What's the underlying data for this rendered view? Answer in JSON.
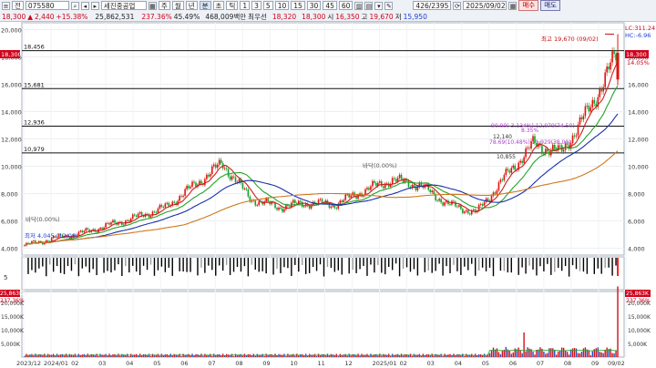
{
  "toolbar": {
    "market": "전",
    "code": "075580",
    "name": "세진중공업",
    "periods": [
      "주",
      "월",
      "년",
      "분",
      "초",
      "틱"
    ],
    "minutes": [
      "1",
      "3",
      "5",
      "10",
      "15",
      "30",
      "45",
      "60"
    ],
    "count": "426",
    "total": "2395",
    "date": "2025/09/02",
    "buy": "매수",
    "sell": "매도",
    "price_line": {
      "price": "18,300",
      "arrow": "▲",
      "change": "2,440",
      "change_pct": "+15.38%",
      "volume": "25,862,531",
      "vol_pct": "237.36%",
      "turnover_rate": "45.49%",
      "amount": "468,009백만",
      "priority": "최우선",
      "bid": "18,320",
      "close": "18,300",
      "open_label": "시",
      "open": "16,350",
      "high_label": "고",
      "high": "19,670",
      "low_label": "저",
      "low": "15,950"
    }
  },
  "price_chart": {
    "y_ticks": [
      "20,000",
      "18,000",
      "16,000",
      "14,000",
      "12,000",
      "10,000",
      "8,000",
      "6,000",
      "4,000"
    ],
    "right_ticks": [
      "20,000",
      "18,000",
      "16,000",
      "14,000",
      "12,000",
      "10,000",
      "8,000",
      "6,000",
      "4,000"
    ],
    "right_top_1": "LC:311.24",
    "right_top_2": "HC:-6.96",
    "price_badge_left": "18,300",
    "price_badge_right": "18,300",
    "price_badge_pct": "14.05%",
    "h_levels": [
      "18,456",
      "15,681",
      "12,936",
      "10,979"
    ],
    "high_annot": "최고 19,670 (09/02)",
    "low_annot": "최저 4,045 (12/09)",
    "box1": "바닥(0.00%)",
    "box2": "바닥(0.00%)",
    "fib1": "90.00(-3.134%) 12,979(74.50)",
    "fib2": "78.69(10.48%) 11,929(38.00)",
    "small1": "12,140",
    "small2": "10,855",
    "small3": "8.35%"
  },
  "volume_panel": {
    "label_left": "5",
    "colors": {
      "up": "#000000",
      "gray": "#9a9a9a",
      "red": "#ff2020"
    }
  },
  "amount_panel": {
    "badge_left": "25,863K",
    "pct_left": "237.36%",
    "badge_right": "25,863K",
    "pct_right": "237.36%",
    "y_ticks": [
      "20,000K",
      "15,000K",
      "10,000K",
      "5,000K"
    ]
  },
  "x_axis": {
    "labels": [
      "2023/12",
      "2024/01",
      "02",
      "03",
      "04",
      "05",
      "06",
      "07",
      "08",
      "09",
      "10",
      "11",
      "12",
      "2025/01",
      "02",
      "03",
      "04",
      "05",
      "06",
      "07",
      "08",
      "09",
      "09/02"
    ]
  },
  "chart_data": {
    "type": "candlestick",
    "price_high": 19670,
    "price_low": 4045,
    "last_close": 18300,
    "levels": [
      18456,
      15681,
      12936,
      10979
    ],
    "close_path": [
      {
        "x": "2023/12",
        "y": 4200
      },
      {
        "x": "2024/01",
        "y": 4700
      },
      {
        "x": "02",
        "y": 5100
      },
      {
        "x": "03",
        "y": 5700
      },
      {
        "x": "04",
        "y": 6300
      },
      {
        "x": "05",
        "y": 7000
      },
      {
        "x": "06",
        "y": 8600
      },
      {
        "x": "07",
        "y": 10200
      },
      {
        "x": "08",
        "y": 7600
      },
      {
        "x": "09",
        "y": 7000
      },
      {
        "x": "10",
        "y": 7300
      },
      {
        "x": "11",
        "y": 7200
      },
      {
        "x": "12",
        "y": 8200
      },
      {
        "x": "2025/01",
        "y": 9000
      },
      {
        "x": "02",
        "y": 8600
      },
      {
        "x": "03",
        "y": 7200
      },
      {
        "x": "04",
        "y": 6600
      },
      {
        "x": "05",
        "y": 9200
      },
      {
        "x": "06",
        "y": 11600
      },
      {
        "x": "07",
        "y": 11000
      },
      {
        "x": "08",
        "y": 14200
      },
      {
        "x": "09",
        "y": 18300
      }
    ]
  }
}
